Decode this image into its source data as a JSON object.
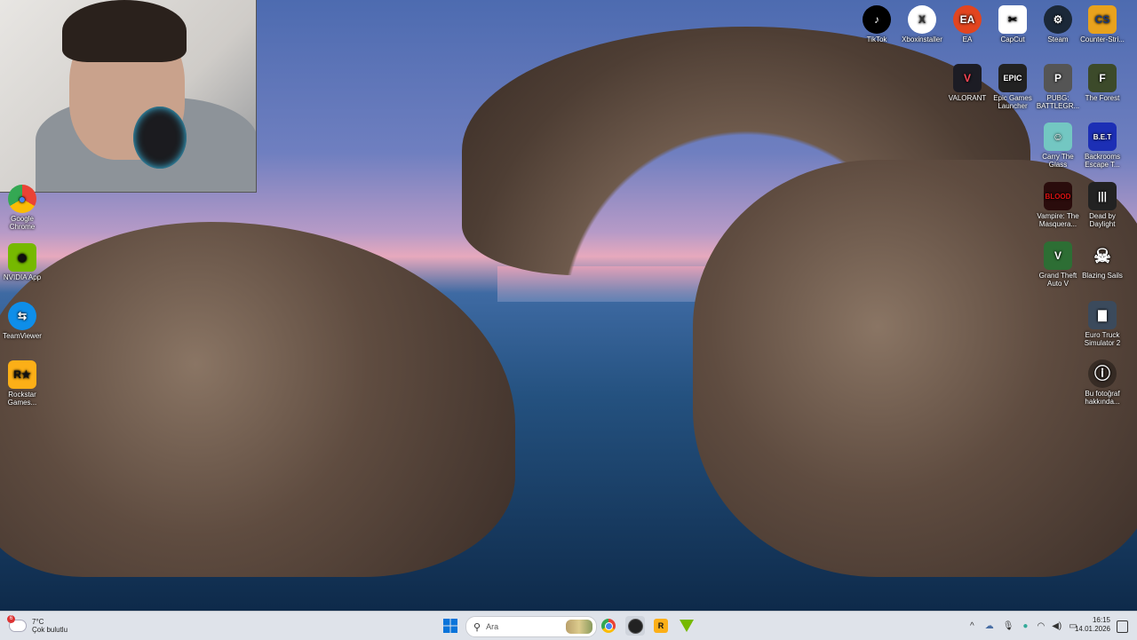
{
  "desktop_icons": {
    "top_row": [
      {
        "label": "TikTok",
        "icon": "tiktok-icon",
        "color": "#000000"
      },
      {
        "label": "Xboxinstaller",
        "icon": "xbox-icon",
        "color": "#ffffff"
      },
      {
        "label": "EA",
        "icon": "ea-icon",
        "color": "#e2451f"
      },
      {
        "label": "CapCut",
        "icon": "capcut-icon",
        "color": "#ffffff"
      },
      {
        "label": "Steam",
        "icon": "steam-icon",
        "color": "#1b2838"
      },
      {
        "label": "Counter-Stri...",
        "icon": "counter-strike-icon",
        "color": "#e8a21d"
      }
    ],
    "row2": [
      {
        "label": "VALORANT",
        "icon": "valorant-icon",
        "color": "#ff4655"
      },
      {
        "label": "Epic Games Launcher",
        "icon": "epic-games-icon",
        "color": "#222222"
      },
      {
        "label": "PUBG: BATTLEGR...",
        "icon": "pubg-icon",
        "color": "#444444"
      },
      {
        "label": "The Forest",
        "icon": "the-forest-icon",
        "color": "#3c4a2a"
      }
    ],
    "right_column": [
      {
        "label": "Carry The Glass",
        "icon": "carry-the-glass-icon",
        "color": "#73c7c2"
      },
      {
        "label": "Backrooms Escape T...",
        "icon": "backrooms-icon",
        "color": "#1c2fb5"
      },
      {
        "label": "Vampire: The Masquera...",
        "icon": "vampire-icon",
        "color": "#b3121a"
      },
      {
        "label": "Dead by Daylight",
        "icon": "dead-by-daylight-icon",
        "color": "#222222"
      },
      {
        "label": "Grand Theft Auto V",
        "icon": "gta-v-icon",
        "color": "#2d6e34"
      },
      {
        "label": "Blazing Sails",
        "icon": "blazing-sails-icon",
        "color": "#333333"
      },
      {
        "label": "Euro Truck Simulator 2",
        "icon": "euro-truck-icon",
        "color": "#3b4a5c"
      },
      {
        "label": "Bu fotoğraf hakkında...",
        "icon": "about-photo-icon",
        "color": "#333333"
      }
    ],
    "left_column": [
      {
        "label": "Google Chrome",
        "icon": "chrome-icon",
        "color": "#34a853"
      },
      {
        "label": "NVIDIA App",
        "icon": "nvidia-icon",
        "color": "#76b900"
      },
      {
        "label": "TeamViewer",
        "icon": "teamviewer-icon",
        "color": "#0e8ee9"
      },
      {
        "label": "Rockstar Games...",
        "icon": "rockstar-icon",
        "color": "#fcaf17"
      }
    ]
  },
  "glyphs": {
    "tiktok": "♪",
    "xbox": "X",
    "ea": "EA",
    "capcut": "✂",
    "steam": "⚙",
    "cs": "CS",
    "valorant": "V",
    "epic": "EPIC",
    "pubg": "P",
    "forest": "F",
    "carry": "☺",
    "backrooms": "B.E.T",
    "vampire": "BLOOD",
    "dbd": "|||",
    "gta": "V",
    "sails": "☠",
    "truck": "▇",
    "about": "ⓘ",
    "chrome": "●",
    "nvidia": "◉",
    "teamviewer": "⇆",
    "rockstar": "R★"
  },
  "taskbar": {
    "weather_temp": "7°C",
    "weather_desc": "Çok bulutlu",
    "weather_badge": "6",
    "search_placeholder": "Ara",
    "start_icon": "windows-start-icon",
    "pinned": [
      {
        "name": "chrome",
        "icon": "chrome-icon"
      },
      {
        "name": "obs",
        "icon": "obs-icon"
      },
      {
        "name": "rockstar",
        "icon": "rockstar-icon"
      },
      {
        "name": "nvidia",
        "icon": "nvidia-icon"
      }
    ],
    "time": "16:15",
    "date": "14.01.2026",
    "tray_chevron": "^"
  },
  "colors": {
    "taskbar_bg": "#dfe3ea",
    "accent": "#0067c0"
  }
}
